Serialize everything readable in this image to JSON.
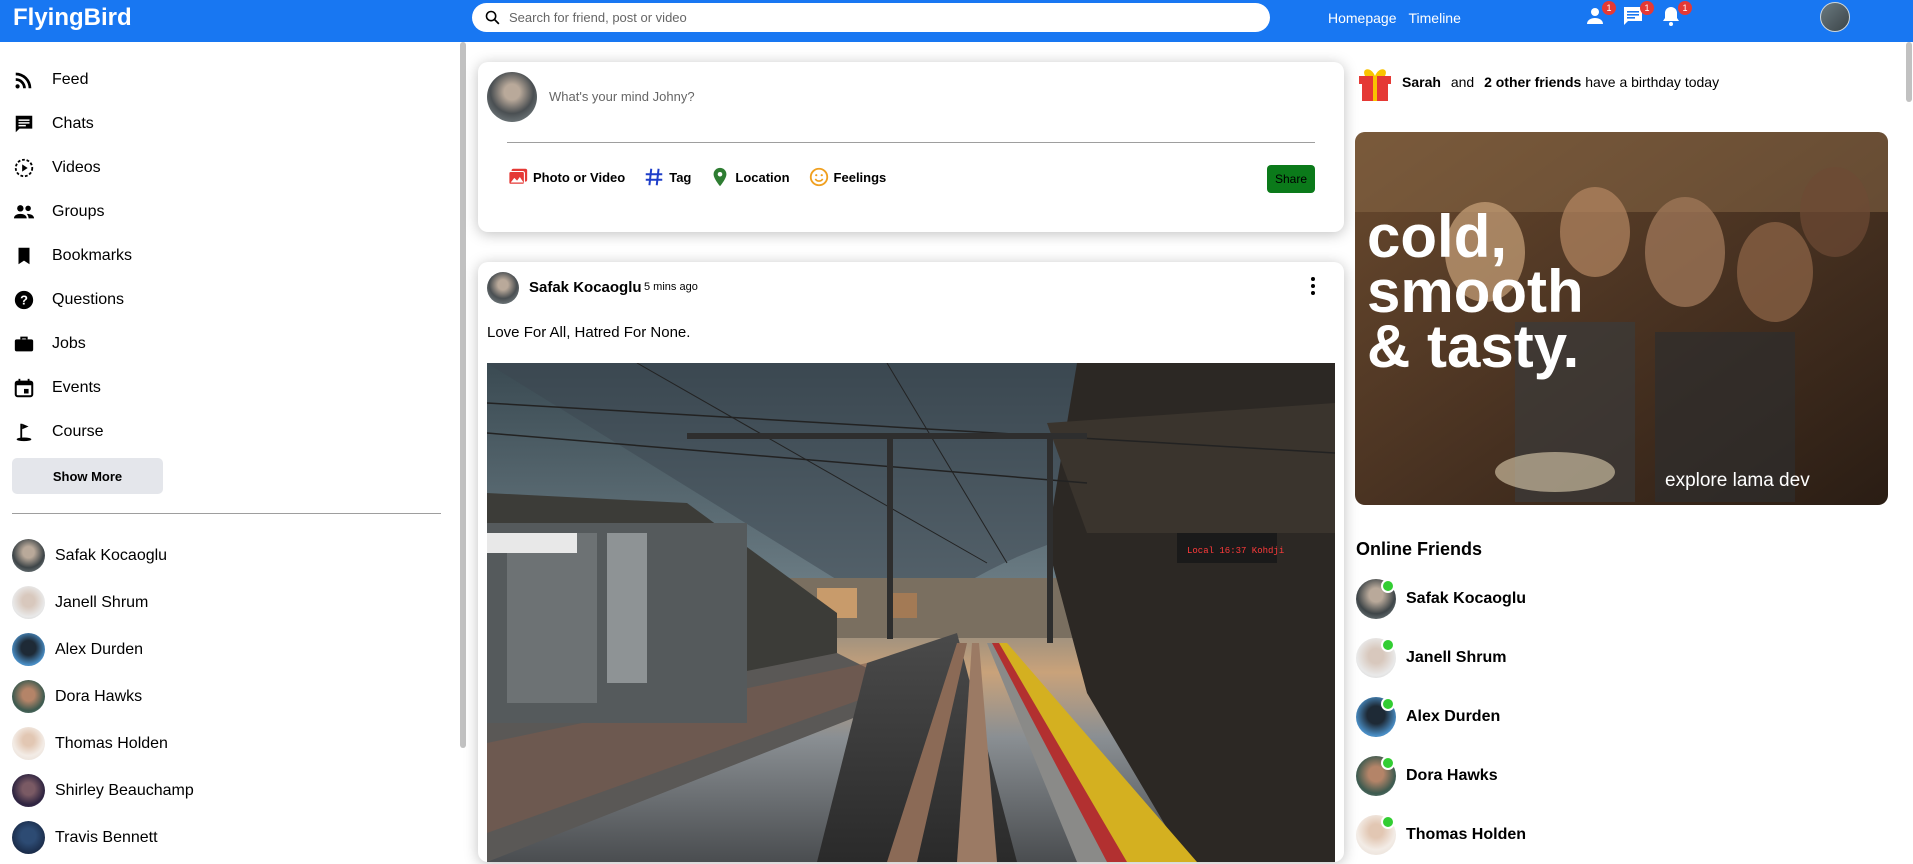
{
  "topbar": {
    "logo": "FlyingBird",
    "search_placeholder": "Search for friend, post or video",
    "links": [
      "Homepage",
      "Timeline"
    ],
    "badges": {
      "friends": "1",
      "messages": "1",
      "notifications": "1"
    },
    "accent": "#1877f2"
  },
  "sidebar": {
    "items": [
      {
        "label": "Feed",
        "icon": "rss-icon"
      },
      {
        "label": "Chats",
        "icon": "chat-icon"
      },
      {
        "label": "Videos",
        "icon": "play-circle-icon"
      },
      {
        "label": "Groups",
        "icon": "group-icon"
      },
      {
        "label": "Bookmarks",
        "icon": "bookmark-icon"
      },
      {
        "label": "Questions",
        "icon": "help-circle-icon"
      },
      {
        "label": "Jobs",
        "icon": "work-icon"
      },
      {
        "label": "Events",
        "icon": "event-icon"
      },
      {
        "label": "Course",
        "icon": "school-icon"
      }
    ],
    "show_more": "Show More",
    "friends": [
      "Safak Kocaoglu",
      "Janell Shrum",
      "Alex Durden",
      "Dora Hawks",
      "Thomas Holden",
      "Shirley Beauchamp",
      "Travis Bennett"
    ]
  },
  "share": {
    "placeholder": "What's your mind Johny?",
    "options": [
      {
        "label": "Photo or Video",
        "icon": "photo-icon",
        "color": "#e53935"
      },
      {
        "label": "Tag",
        "icon": "hashtag-icon",
        "color": "#1e3ec9"
      },
      {
        "label": "Location",
        "icon": "location-icon",
        "color": "#2e7d32"
      },
      {
        "label": "Feelings",
        "icon": "emoji-icon",
        "color": "#f0a020"
      }
    ],
    "share_button": "Share"
  },
  "post": {
    "username": "Safak Kocaoglu",
    "time": "5 mins ago",
    "text": "Love For All, Hatred For None.",
    "image_sign": "Local 16:37 Kohdji"
  },
  "rightbar": {
    "birthday": {
      "name": "Sarah",
      "and": "and",
      "others": "2 other friends",
      "suffix": "have a birthday today"
    },
    "ad": {
      "headline_1": "cold,",
      "headline_2": "smooth",
      "headline_3": "& tasty.",
      "tagline": "explore lama dev"
    },
    "online_title": "Online Friends",
    "online_friends": [
      "Safak Kocaoglu",
      "Janell Shrum",
      "Alex Durden",
      "Dora Hawks",
      "Thomas Holden"
    ]
  }
}
